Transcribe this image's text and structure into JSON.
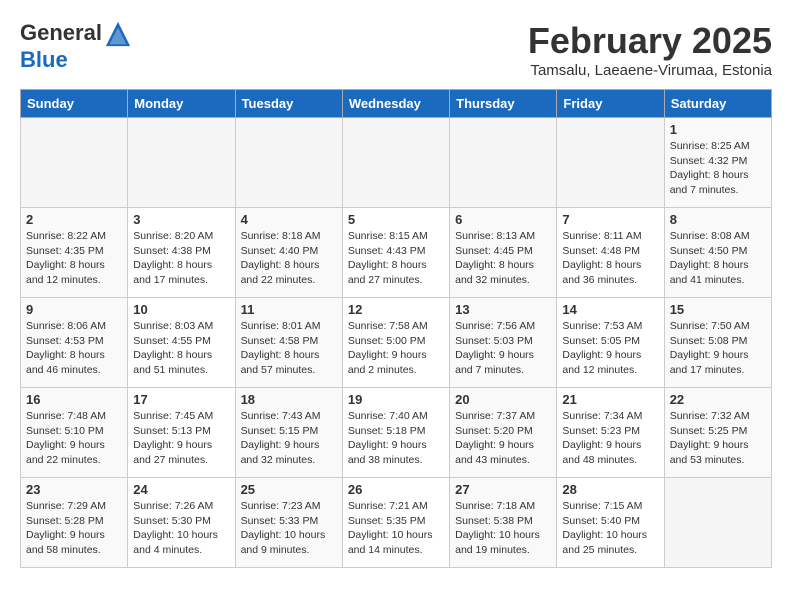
{
  "header": {
    "logo_general": "General",
    "logo_blue": "Blue",
    "month_title": "February 2025",
    "location": "Tamsalu, Laeaene-Virumaa, Estonia"
  },
  "weekdays": [
    "Sunday",
    "Monday",
    "Tuesday",
    "Wednesday",
    "Thursday",
    "Friday",
    "Saturday"
  ],
  "weeks": [
    [
      {
        "day": "",
        "info": ""
      },
      {
        "day": "",
        "info": ""
      },
      {
        "day": "",
        "info": ""
      },
      {
        "day": "",
        "info": ""
      },
      {
        "day": "",
        "info": ""
      },
      {
        "day": "",
        "info": ""
      },
      {
        "day": "1",
        "info": "Sunrise: 8:25 AM\nSunset: 4:32 PM\nDaylight: 8 hours and 7 minutes."
      }
    ],
    [
      {
        "day": "2",
        "info": "Sunrise: 8:22 AM\nSunset: 4:35 PM\nDaylight: 8 hours and 12 minutes."
      },
      {
        "day": "3",
        "info": "Sunrise: 8:20 AM\nSunset: 4:38 PM\nDaylight: 8 hours and 17 minutes."
      },
      {
        "day": "4",
        "info": "Sunrise: 8:18 AM\nSunset: 4:40 PM\nDaylight: 8 hours and 22 minutes."
      },
      {
        "day": "5",
        "info": "Sunrise: 8:15 AM\nSunset: 4:43 PM\nDaylight: 8 hours and 27 minutes."
      },
      {
        "day": "6",
        "info": "Sunrise: 8:13 AM\nSunset: 4:45 PM\nDaylight: 8 hours and 32 minutes."
      },
      {
        "day": "7",
        "info": "Sunrise: 8:11 AM\nSunset: 4:48 PM\nDaylight: 8 hours and 36 minutes."
      },
      {
        "day": "8",
        "info": "Sunrise: 8:08 AM\nSunset: 4:50 PM\nDaylight: 8 hours and 41 minutes."
      }
    ],
    [
      {
        "day": "9",
        "info": "Sunrise: 8:06 AM\nSunset: 4:53 PM\nDaylight: 8 hours and 46 minutes."
      },
      {
        "day": "10",
        "info": "Sunrise: 8:03 AM\nSunset: 4:55 PM\nDaylight: 8 hours and 51 minutes."
      },
      {
        "day": "11",
        "info": "Sunrise: 8:01 AM\nSunset: 4:58 PM\nDaylight: 8 hours and 57 minutes."
      },
      {
        "day": "12",
        "info": "Sunrise: 7:58 AM\nSunset: 5:00 PM\nDaylight: 9 hours and 2 minutes."
      },
      {
        "day": "13",
        "info": "Sunrise: 7:56 AM\nSunset: 5:03 PM\nDaylight: 9 hours and 7 minutes."
      },
      {
        "day": "14",
        "info": "Sunrise: 7:53 AM\nSunset: 5:05 PM\nDaylight: 9 hours and 12 minutes."
      },
      {
        "day": "15",
        "info": "Sunrise: 7:50 AM\nSunset: 5:08 PM\nDaylight: 9 hours and 17 minutes."
      }
    ],
    [
      {
        "day": "16",
        "info": "Sunrise: 7:48 AM\nSunset: 5:10 PM\nDaylight: 9 hours and 22 minutes."
      },
      {
        "day": "17",
        "info": "Sunrise: 7:45 AM\nSunset: 5:13 PM\nDaylight: 9 hours and 27 minutes."
      },
      {
        "day": "18",
        "info": "Sunrise: 7:43 AM\nSunset: 5:15 PM\nDaylight: 9 hours and 32 minutes."
      },
      {
        "day": "19",
        "info": "Sunrise: 7:40 AM\nSunset: 5:18 PM\nDaylight: 9 hours and 38 minutes."
      },
      {
        "day": "20",
        "info": "Sunrise: 7:37 AM\nSunset: 5:20 PM\nDaylight: 9 hours and 43 minutes."
      },
      {
        "day": "21",
        "info": "Sunrise: 7:34 AM\nSunset: 5:23 PM\nDaylight: 9 hours and 48 minutes."
      },
      {
        "day": "22",
        "info": "Sunrise: 7:32 AM\nSunset: 5:25 PM\nDaylight: 9 hours and 53 minutes."
      }
    ],
    [
      {
        "day": "23",
        "info": "Sunrise: 7:29 AM\nSunset: 5:28 PM\nDaylight: 9 hours and 58 minutes."
      },
      {
        "day": "24",
        "info": "Sunrise: 7:26 AM\nSunset: 5:30 PM\nDaylight: 10 hours and 4 minutes."
      },
      {
        "day": "25",
        "info": "Sunrise: 7:23 AM\nSunset: 5:33 PM\nDaylight: 10 hours and 9 minutes."
      },
      {
        "day": "26",
        "info": "Sunrise: 7:21 AM\nSunset: 5:35 PM\nDaylight: 10 hours and 14 minutes."
      },
      {
        "day": "27",
        "info": "Sunrise: 7:18 AM\nSunset: 5:38 PM\nDaylight: 10 hours and 19 minutes."
      },
      {
        "day": "28",
        "info": "Sunrise: 7:15 AM\nSunset: 5:40 PM\nDaylight: 10 hours and 25 minutes."
      },
      {
        "day": "",
        "info": ""
      }
    ]
  ]
}
